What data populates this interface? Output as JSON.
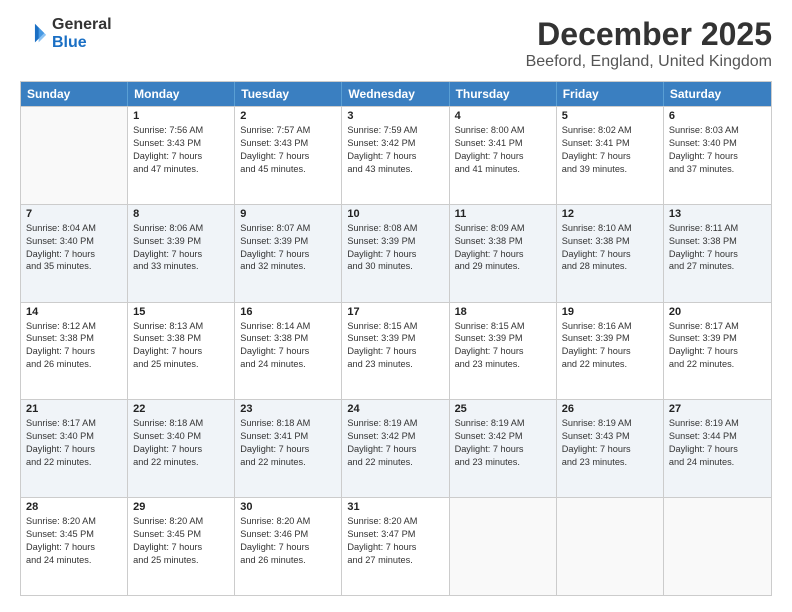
{
  "logo": {
    "line1": "General",
    "line2": "Blue"
  },
  "title": "December 2025",
  "subtitle": "Beeford, England, United Kingdom",
  "days_of_week": [
    "Sunday",
    "Monday",
    "Tuesday",
    "Wednesday",
    "Thursday",
    "Friday",
    "Saturday"
  ],
  "weeks": [
    [
      {
        "day": "",
        "sunrise": "",
        "sunset": "",
        "daylight": ""
      },
      {
        "day": "1",
        "sunrise": "Sunrise: 7:56 AM",
        "sunset": "Sunset: 3:43 PM",
        "daylight": "Daylight: 7 hours and 47 minutes."
      },
      {
        "day": "2",
        "sunrise": "Sunrise: 7:57 AM",
        "sunset": "Sunset: 3:43 PM",
        "daylight": "Daylight: 7 hours and 45 minutes."
      },
      {
        "day": "3",
        "sunrise": "Sunrise: 7:59 AM",
        "sunset": "Sunset: 3:42 PM",
        "daylight": "Daylight: 7 hours and 43 minutes."
      },
      {
        "day": "4",
        "sunrise": "Sunrise: 8:00 AM",
        "sunset": "Sunset: 3:41 PM",
        "daylight": "Daylight: 7 hours and 41 minutes."
      },
      {
        "day": "5",
        "sunrise": "Sunrise: 8:02 AM",
        "sunset": "Sunset: 3:41 PM",
        "daylight": "Daylight: 7 hours and 39 minutes."
      },
      {
        "day": "6",
        "sunrise": "Sunrise: 8:03 AM",
        "sunset": "Sunset: 3:40 PM",
        "daylight": "Daylight: 7 hours and 37 minutes."
      }
    ],
    [
      {
        "day": "7",
        "sunrise": "Sunrise: 8:04 AM",
        "sunset": "Sunset: 3:40 PM",
        "daylight": "Daylight: 7 hours and 35 minutes."
      },
      {
        "day": "8",
        "sunrise": "Sunrise: 8:06 AM",
        "sunset": "Sunset: 3:39 PM",
        "daylight": "Daylight: 7 hours and 33 minutes."
      },
      {
        "day": "9",
        "sunrise": "Sunrise: 8:07 AM",
        "sunset": "Sunset: 3:39 PM",
        "daylight": "Daylight: 7 hours and 32 minutes."
      },
      {
        "day": "10",
        "sunrise": "Sunrise: 8:08 AM",
        "sunset": "Sunset: 3:39 PM",
        "daylight": "Daylight: 7 hours and 30 minutes."
      },
      {
        "day": "11",
        "sunrise": "Sunrise: 8:09 AM",
        "sunset": "Sunset: 3:38 PM",
        "daylight": "Daylight: 7 hours and 29 minutes."
      },
      {
        "day": "12",
        "sunrise": "Sunrise: 8:10 AM",
        "sunset": "Sunset: 3:38 PM",
        "daylight": "Daylight: 7 hours and 28 minutes."
      },
      {
        "day": "13",
        "sunrise": "Sunrise: 8:11 AM",
        "sunset": "Sunset: 3:38 PM",
        "daylight": "Daylight: 7 hours and 27 minutes."
      }
    ],
    [
      {
        "day": "14",
        "sunrise": "Sunrise: 8:12 AM",
        "sunset": "Sunset: 3:38 PM",
        "daylight": "Daylight: 7 hours and 26 minutes."
      },
      {
        "day": "15",
        "sunrise": "Sunrise: 8:13 AM",
        "sunset": "Sunset: 3:38 PM",
        "daylight": "Daylight: 7 hours and 25 minutes."
      },
      {
        "day": "16",
        "sunrise": "Sunrise: 8:14 AM",
        "sunset": "Sunset: 3:38 PM",
        "daylight": "Daylight: 7 hours and 24 minutes."
      },
      {
        "day": "17",
        "sunrise": "Sunrise: 8:15 AM",
        "sunset": "Sunset: 3:39 PM",
        "daylight": "Daylight: 7 hours and 23 minutes."
      },
      {
        "day": "18",
        "sunrise": "Sunrise: 8:15 AM",
        "sunset": "Sunset: 3:39 PM",
        "daylight": "Daylight: 7 hours and 23 minutes."
      },
      {
        "day": "19",
        "sunrise": "Sunrise: 8:16 AM",
        "sunset": "Sunset: 3:39 PM",
        "daylight": "Daylight: 7 hours and 22 minutes."
      },
      {
        "day": "20",
        "sunrise": "Sunrise: 8:17 AM",
        "sunset": "Sunset: 3:39 PM",
        "daylight": "Daylight: 7 hours and 22 minutes."
      }
    ],
    [
      {
        "day": "21",
        "sunrise": "Sunrise: 8:17 AM",
        "sunset": "Sunset: 3:40 PM",
        "daylight": "Daylight: 7 hours and 22 minutes."
      },
      {
        "day": "22",
        "sunrise": "Sunrise: 8:18 AM",
        "sunset": "Sunset: 3:40 PM",
        "daylight": "Daylight: 7 hours and 22 minutes."
      },
      {
        "day": "23",
        "sunrise": "Sunrise: 8:18 AM",
        "sunset": "Sunset: 3:41 PM",
        "daylight": "Daylight: 7 hours and 22 minutes."
      },
      {
        "day": "24",
        "sunrise": "Sunrise: 8:19 AM",
        "sunset": "Sunset: 3:42 PM",
        "daylight": "Daylight: 7 hours and 22 minutes."
      },
      {
        "day": "25",
        "sunrise": "Sunrise: 8:19 AM",
        "sunset": "Sunset: 3:42 PM",
        "daylight": "Daylight: 7 hours and 23 minutes."
      },
      {
        "day": "26",
        "sunrise": "Sunrise: 8:19 AM",
        "sunset": "Sunset: 3:43 PM",
        "daylight": "Daylight: 7 hours and 23 minutes."
      },
      {
        "day": "27",
        "sunrise": "Sunrise: 8:19 AM",
        "sunset": "Sunset: 3:44 PM",
        "daylight": "Daylight: 7 hours and 24 minutes."
      }
    ],
    [
      {
        "day": "28",
        "sunrise": "Sunrise: 8:20 AM",
        "sunset": "Sunset: 3:45 PM",
        "daylight": "Daylight: 7 hours and 24 minutes."
      },
      {
        "day": "29",
        "sunrise": "Sunrise: 8:20 AM",
        "sunset": "Sunset: 3:45 PM",
        "daylight": "Daylight: 7 hours and 25 minutes."
      },
      {
        "day": "30",
        "sunrise": "Sunrise: 8:20 AM",
        "sunset": "Sunset: 3:46 PM",
        "daylight": "Daylight: 7 hours and 26 minutes."
      },
      {
        "day": "31",
        "sunrise": "Sunrise: 8:20 AM",
        "sunset": "Sunset: 3:47 PM",
        "daylight": "Daylight: 7 hours and 27 minutes."
      },
      {
        "day": "",
        "sunrise": "",
        "sunset": "",
        "daylight": ""
      },
      {
        "day": "",
        "sunrise": "",
        "sunset": "",
        "daylight": ""
      },
      {
        "day": "",
        "sunrise": "",
        "sunset": "",
        "daylight": ""
      }
    ]
  ]
}
